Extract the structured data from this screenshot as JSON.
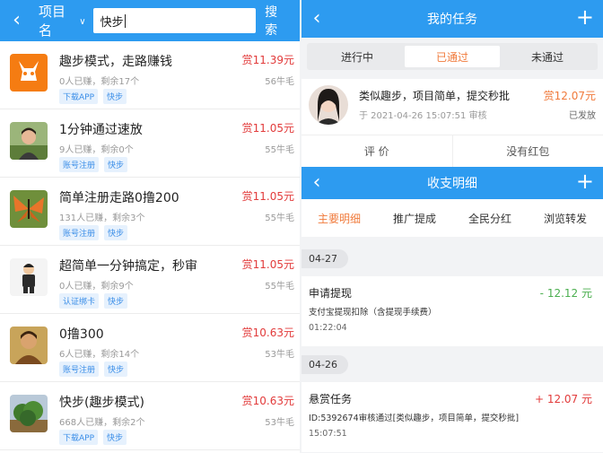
{
  "left": {
    "header": {
      "project_label": "项目名",
      "search_value": "快步",
      "search_button": "搜 索"
    },
    "tasks": [
      {
        "title": "趣步模式，走路赚钱",
        "meta": "0人已赚，剩余17个",
        "tags": [
          "下载APP",
          "快步"
        ],
        "reward": "赏11.39元",
        "coin": "56牛毛",
        "icon": "orange-llama-icon"
      },
      {
        "title": "1分钟通过速放",
        "meta": "9人已赚，剩余0个",
        "tags": [
          "账号注册",
          "快步"
        ],
        "reward": "赏11.05元",
        "coin": "55牛毛",
        "icon": "portrait-avatar"
      },
      {
        "title": "简单注册走路0撸200",
        "meta": "131人已赚，剩余3个",
        "tags": [
          "账号注册",
          "快步"
        ],
        "reward": "赏11.05元",
        "coin": "55牛毛",
        "icon": "butterfly-avatar"
      },
      {
        "title": "超简单一分钟搞定，秒审",
        "meta": "0人已赚，剩余9个",
        "tags": [
          "认证绑卡",
          "快步"
        ],
        "reward": "赏11.05元",
        "coin": "55牛毛",
        "icon": "cartoon-man-avatar"
      },
      {
        "title": "0撸300",
        "meta": "6人已赚，剩余14个",
        "tags": [
          "账号注册",
          "快步"
        ],
        "reward": "赏10.63元",
        "coin": "53牛毛",
        "icon": "warrior-avatar"
      },
      {
        "title": "快步(趣步模式)",
        "meta": "668人已赚，剩余2个",
        "tags": [
          "下载APP",
          "快步"
        ],
        "reward": "赏10.63元",
        "coin": "53牛毛",
        "icon": "tree-avatar"
      }
    ]
  },
  "right": {
    "my_task": {
      "title": "我的任务",
      "tabs": [
        "进行中",
        "已通过",
        "未通过"
      ],
      "active_tab": 1,
      "item": {
        "title": "类似趣步，项目简单，提交秒批",
        "time": "于 2021-04-26 15:07:51 审核",
        "reward": "赏12.07元",
        "status": "已发放"
      },
      "actions": [
        "评 价",
        "没有红包"
      ]
    },
    "ledger": {
      "title": "收支明细",
      "tabs": [
        "主要明细",
        "推广提成",
        "全民分红",
        "浏览转发"
      ],
      "active_tab": 0,
      "groups": [
        {
          "date": "04-27",
          "title": "申请提现",
          "desc": "支付宝提现扣除（含提现手续费）",
          "time": "01:22:04",
          "amount": "- 12.12 元"
        },
        {
          "date": "04-26",
          "title": "悬赏任务",
          "desc": "ID:5392674审核通过[类似趣步，项目简单，提交秒批]",
          "time": "15:07:51",
          "amount": "+ 12.07 元"
        }
      ]
    }
  },
  "colors": {
    "header_blue": "#2d9bf0",
    "accent_orange": "#f07a3b",
    "reward_red": "#e23b3b",
    "withdraw_green": "#4caf50"
  }
}
